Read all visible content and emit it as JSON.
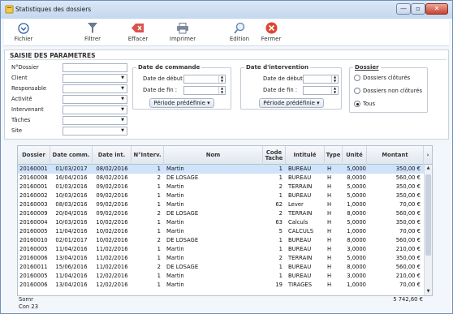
{
  "window": {
    "title": "Statistiques des dossiers",
    "minimize": "—",
    "maximize": "▫",
    "close": "✕"
  },
  "toolbar": {
    "fichier": "Fichier",
    "filtrer": "Filtrer",
    "effacer": "Effacer",
    "imprimer": "Imprimer",
    "edition": "Edition",
    "fermer": "Fermer"
  },
  "form": {
    "section_title": "SAISIE DES PARAMETRES",
    "fields": [
      {
        "label": "N°Dossier",
        "value": ""
      },
      {
        "label": "Client",
        "value": ""
      },
      {
        "label": "Responsable",
        "value": ""
      },
      {
        "label": "Activité",
        "value": ""
      },
      {
        "label": "Intervenant",
        "value": ""
      },
      {
        "label": "Tâches",
        "value": ""
      },
      {
        "label": "Site",
        "value": ""
      }
    ],
    "commande": {
      "title": "Date de commande",
      "debut_label": "Date de début :",
      "fin_label": "Date de fin :",
      "period_button": "Période prédéfinie ▾"
    },
    "intervention": {
      "title": "Date d'intervention",
      "debut_label": "Date de début :",
      "fin_label": "Date de fin :",
      "period_button": "Période prédéfinie ▾"
    },
    "dossier": {
      "title": "Dossier",
      "options": [
        "Dossiers clôturés",
        "Dossiers non clôturés",
        "Tous"
      ],
      "selected": "Tous"
    }
  },
  "table": {
    "headers": [
      "Dossier",
      "Date comm.",
      "Date int.",
      "N°Interv.",
      "Nom",
      "Code Tache",
      "Intitulé",
      "Type",
      "Unité",
      "Montant"
    ],
    "rows": [
      [
        "20160001",
        "01/03/2017",
        "08/02/2016",
        "1",
        "Martin",
        "1",
        "BUREAU",
        "H",
        "5,0000",
        "350,00 €"
      ],
      [
        "20160008",
        "16/04/2016",
        "08/02/2016",
        "2",
        "DE LOSAGE",
        "1",
        "BUREAU",
        "H",
        "8,0000",
        "560,00 €"
      ],
      [
        "20160001",
        "01/03/2016",
        "09/02/2016",
        "1",
        "Martin",
        "2",
        "TERRAIN",
        "H",
        "5,0000",
        "350,00 €"
      ],
      [
        "20160002",
        "10/03/2016",
        "09/02/2016",
        "1",
        "Martin",
        "1",
        "BUREAU",
        "H",
        "5,0000",
        "350,00 €"
      ],
      [
        "20160003",
        "08/03/2016",
        "09/02/2016",
        "1",
        "Martin",
        "62",
        "Lever",
        "H",
        "1,0000",
        "70,00 €"
      ],
      [
        "20160009",
        "20/04/2016",
        "09/02/2016",
        "2",
        "DE LOSAGE",
        "2",
        "TERRAIN",
        "H",
        "8,0000",
        "560,00 €"
      ],
      [
        "20160004",
        "10/03/2016",
        "10/02/2016",
        "1",
        "Martin",
        "63",
        "Calculs",
        "H",
        "5,0000",
        "350,00 €"
      ],
      [
        "20160005",
        "11/04/2016",
        "10/02/2016",
        "1",
        "Martin",
        "5",
        "CALCULS",
        "H",
        "1,0000",
        "70,00 €"
      ],
      [
        "20160010",
        "02/01/2017",
        "10/02/2016",
        "2",
        "DE LOSAGE",
        "1",
        "BUREAU",
        "H",
        "8,0000",
        "560,00 €"
      ],
      [
        "20160005",
        "11/04/2016",
        "11/02/2016",
        "1",
        "Martin",
        "1",
        "BUREAU",
        "H",
        "3,0000",
        "210,00 €"
      ],
      [
        "20160006",
        "13/04/2016",
        "11/02/2016",
        "1",
        "Martin",
        "2",
        "TERRAIN",
        "H",
        "5,0000",
        "350,00 €"
      ],
      [
        "20160011",
        "15/06/2016",
        "11/02/2016",
        "2",
        "DE LOSAGE",
        "1",
        "BUREAU",
        "H",
        "8,0000",
        "560,00 €"
      ],
      [
        "20160005",
        "11/04/2016",
        "12/02/2016",
        "1",
        "Martin",
        "1",
        "BUREAU",
        "H",
        "3,0000",
        "210,00 €"
      ],
      [
        "20160006",
        "13/04/2016",
        "12/02/2016",
        "1",
        "Martin",
        "19",
        "TIRAGES",
        "H",
        "1,0000",
        "70,00 €"
      ]
    ],
    "sum_label": "Somr",
    "count_label": "Con 23",
    "total": "5 742,60 €"
  },
  "colors": {
    "selection": "#cfe3fb",
    "filter_icon": "#6b7a8d",
    "effacer_icon": "#d9534f",
    "fermer_icon": "#e0452f"
  }
}
